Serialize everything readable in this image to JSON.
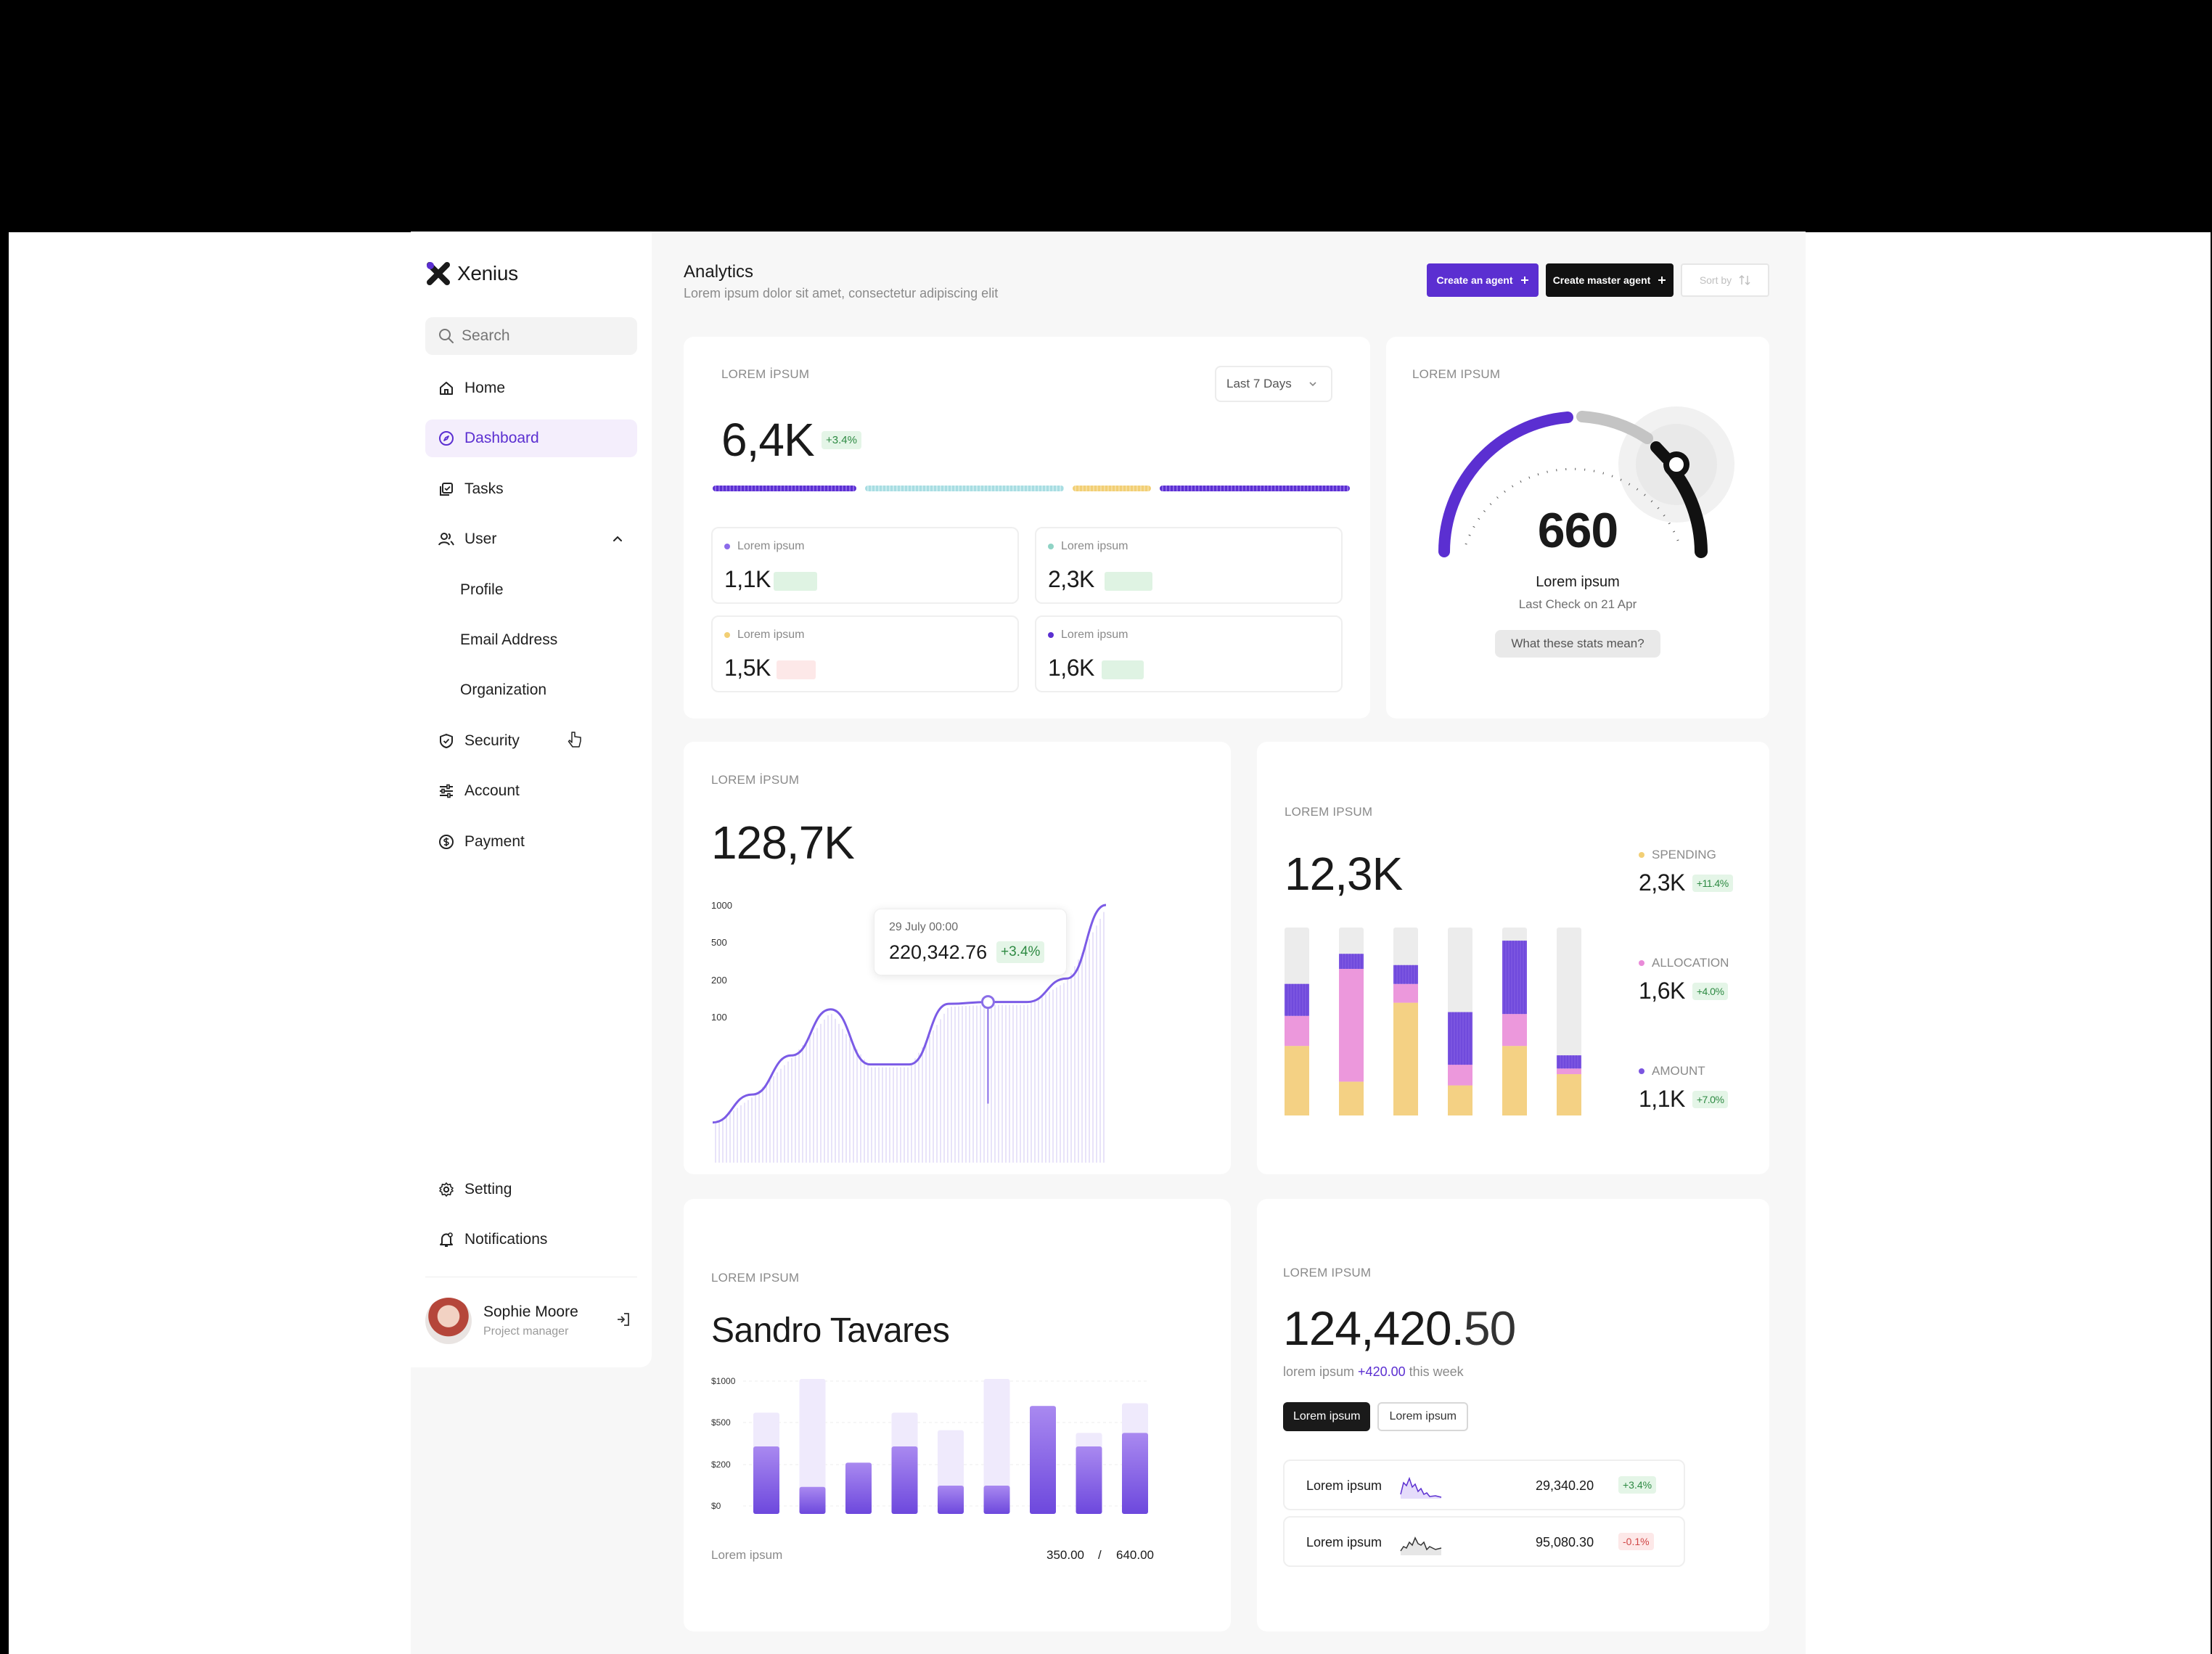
{
  "app": {
    "name": "Xenius"
  },
  "search": {
    "placeholder": "Search"
  },
  "sidebar": {
    "items": [
      {
        "label": "Home"
      },
      {
        "label": "Dashboard"
      },
      {
        "label": "Tasks"
      },
      {
        "label": "User"
      },
      {
        "label": "Profile"
      },
      {
        "label": "Email Address"
      },
      {
        "label": "Organization"
      },
      {
        "label": "Security"
      },
      {
        "label": "Account"
      },
      {
        "label": "Payment"
      }
    ],
    "bottom": [
      {
        "label": "Setting"
      },
      {
        "label": "Notifications"
      }
    ],
    "user": {
      "name": "Sophie Moore",
      "role": "Project manager"
    }
  },
  "header": {
    "title": "Analytics",
    "subtitle": "Lorem ipsum dolor sit amet, consectetur adipiscing elit",
    "create_agent": "Create an agent",
    "create_master": "Create master agent",
    "sort": "Sort by"
  },
  "card_total": {
    "label": "LOREM İPSUM",
    "period": "Last 7 Days",
    "value": "6,4K",
    "change": "+3.4%",
    "segments": [
      {
        "color": "#5b2fd1",
        "share": 0.23
      },
      {
        "color": "#a8dde2",
        "share": 0.32
      },
      {
        "color": "#f2cf75",
        "share": 0.12
      },
      {
        "color": "#5b2fd1",
        "share": 0.3
      }
    ],
    "minis": [
      {
        "label": "Lorem ipsum",
        "value": "1,1K",
        "dot": "#8c6bea",
        "trend": "up"
      },
      {
        "label": "Lorem ipsum",
        "value": "2,3K",
        "dot": "#8fd3c5",
        "trend": "up"
      },
      {
        "label": "Lorem ipsum",
        "value": "1,5K",
        "dot": "#f2cf75",
        "trend": "down"
      },
      {
        "label": "Lorem ipsum",
        "value": "1,6K",
        "dot": "#5b2fd1",
        "trend": "up"
      }
    ]
  },
  "card_gauge": {
    "label": "LOREM IPSUM",
    "value": "660",
    "title": "Lorem ipsum",
    "subtitle": "Last Check on 21 Apr",
    "button": "What these stats mean?"
  },
  "card_line": {
    "label": "LOREM İPSUM",
    "value": "128,7K",
    "tooltip": {
      "date": "29 July 00:00",
      "value": "220,342.76",
      "change": "+3.4%"
    }
  },
  "card_stack": {
    "label": "LOREM IPSUM",
    "value": "12,3K",
    "legend": [
      {
        "name": "SPENDING",
        "value": "2,3K",
        "change": "+11.4%",
        "color": "#f2cf75"
      },
      {
        "name": "ALLOCATION",
        "value": "1,6K",
        "change": "+4.0%",
        "color": "#e98ad8"
      },
      {
        "name": "AMOUNT",
        "value": "1,1K",
        "change": "+7.0%",
        "color": "#7b55e0"
      }
    ]
  },
  "card_bars": {
    "label": "LOREM IPSUM",
    "title": "Sandro Tavares",
    "footer_label": "Lorem ipsum",
    "footer_a": "350.00",
    "footer_sep": "/",
    "footer_b": "640.00"
  },
  "card_balance": {
    "label": "LOREM IPSUM",
    "value_int": "124,420.",
    "value_dec": "50",
    "sub_pre": "lorem ipsum",
    "sub_hl": "+420.00",
    "sub_post": "this week",
    "tab_on": "Lorem ipsum",
    "tab_off": "Lorem ipsum",
    "rows": [
      {
        "name": "Lorem ipsum",
        "value": "29,340.20",
        "change": "+3.4%"
      },
      {
        "name": "Lorem ipsum",
        "value": "95,080.30",
        "change": "-0.1%"
      }
    ]
  },
  "chart_data": [
    {
      "type": "line",
      "yticks": [
        "1000",
        "500",
        "200",
        "100"
      ],
      "x": [
        0,
        1,
        2,
        3,
        4,
        5,
        6,
        7,
        8,
        9,
        10
      ],
      "values": [
        10,
        35,
        70,
        120,
        62,
        62,
        135,
        140,
        140,
        210,
        1000
      ],
      "highlight_index": 7
    },
    {
      "type": "bar",
      "stacked": true,
      "series": [
        {
          "name": "SPENDING",
          "values": [
            0.37,
            0.18,
            0.6,
            0.16,
            0.37,
            0.22
          ]
        },
        {
          "name": "ALLOCATION",
          "values": [
            0.16,
            0.6,
            0.1,
            0.11,
            0.17,
            0.03
          ]
        },
        {
          "name": "AMOUNT",
          "values": [
            0.17,
            0.08,
            0.1,
            0.28,
            0.39,
            0.07
          ]
        }
      ]
    },
    {
      "type": "bar",
      "yticks": [
        "$1000",
        "$500",
        "$200",
        "$0"
      ],
      "categories": [
        "1",
        "2",
        "3",
        "4",
        "5",
        "6",
        "7",
        "8",
        "9"
      ],
      "series": [
        {
          "name": "",
          "values": [
            0.5,
            0.2,
            0.38,
            0.5,
            0.21,
            0.21,
            0.8,
            0.5,
            0.6
          ]
        },
        {
          "name": "",
          "values": [
            0.75,
            1.0,
            0.38,
            0.75,
            0.62,
            1.0,
            0.8,
            0.6,
            0.82
          ]
        }
      ]
    }
  ]
}
